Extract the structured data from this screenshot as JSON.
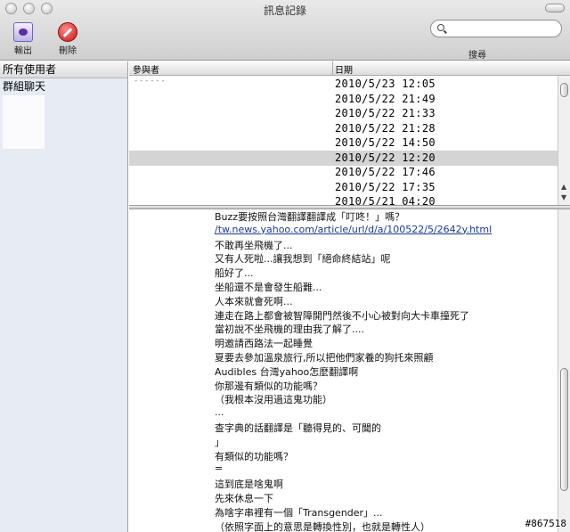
{
  "window": {
    "title": "訊息記錄"
  },
  "toolbar": {
    "export_label": "輸出",
    "delete_label": "刪除",
    "search_label": "搜尋",
    "search_value": ""
  },
  "sidebar": {
    "header": "所有使用者",
    "items": [
      {
        "label": "群組聊天"
      }
    ]
  },
  "list": {
    "columns": {
      "participants": "參與者",
      "date": "日期"
    },
    "rows": [
      {
        "sender": "- - - - - -",
        "date": "2010/5/23 12:05"
      },
      {
        "sender": "",
        "date": "2010/5/22 21:49"
      },
      {
        "sender": "",
        "date": "2010/5/22 21:33"
      },
      {
        "sender": "",
        "date": "2010/5/22 21:28"
      },
      {
        "sender": "",
        "date": "2010/5/22 14:50"
      },
      {
        "sender": "",
        "date": "2010/5/22 12:20"
      },
      {
        "sender": "",
        "date": "2010/5/22 17:46"
      },
      {
        "sender": "",
        "date": "2010/5/22 17:35"
      },
      {
        "sender": "",
        "date": "2010/5/21 04:20"
      }
    ],
    "selected_index": 5
  },
  "transcript": {
    "lines": [
      "Buzz要按照台灣翻譯翻譯成「叮咚！」嗎？",
      "/tw.news.yahoo.com/article/url/d/a/100522/5/2642y.html",
      "不敢再坐飛機了...",
      "又有人死啦...讓我想到「絕命終結站」呢",
      "船好了...",
      "坐船還不是會發生船難...",
      "人本來就會死啊...",
      "連走在路上都會被智障開門然後不小心被對向大卡車撞死了",
      "當初說不坐飛機的理由我了解了....",
      "明邀請西路法一起睡覺",
      "夏要去參加溫泉旅行,所以把他們家養的狗托來照顧",
      "Audibles 台灣yahoo怎麼翻譯啊",
      "你那邊有類似的功能嗎？",
      "（我根本沒用過這鬼功能）",
      "...",
      "查字典的話翻譯是「聽得見的、可聞的",
      "」",
      "有類似的功能嗎？",
      "=",
      "這到底是啥鬼啊",
      "先來休息一下",
      "為啥字串裡有一個「Transgender」...",
      "（依照字面上的意思是轉換性別，也就是轉性人）"
    ],
    "link_index": 1
  },
  "watermark": "#867518"
}
